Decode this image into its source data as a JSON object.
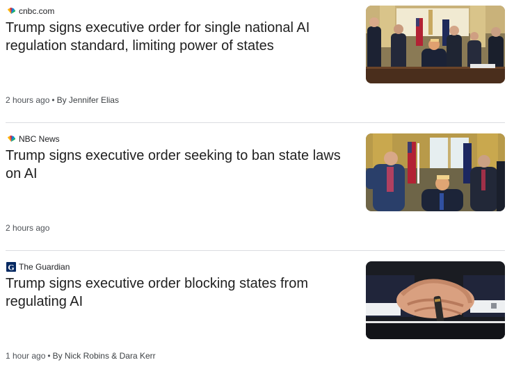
{
  "articles": [
    {
      "source": "cnbc.com",
      "source_icon": "nbc-peacock-icon",
      "headline": "Trump signs executive order for single national AI regulation standard, limiting power of states",
      "time": "2 hours ago",
      "separator": "•",
      "author": "By Jennifer Elias",
      "thumbnail_icon": "oval-office-signing-photo"
    },
    {
      "source": "NBC News",
      "source_icon": "nbc-peacock-icon",
      "headline": "Trump signs executive order seeking to ban state laws on AI",
      "time": "2 hours ago",
      "thumbnail_icon": "oval-office-speaker-photo"
    },
    {
      "source": "The Guardian",
      "source_icon": "guardian-g-icon",
      "headline": "Trump signs executive order blocking states from regulating AI",
      "time": "1 hour ago",
      "separator": "•",
      "author": "By Nick Robins & Dara Kerr",
      "thumbnail_icon": "clasped-hands-photo"
    }
  ],
  "colors": {
    "headline": "#1f1f1f",
    "meta": "#4d5156",
    "divider": "#dadce0",
    "guardian_blue": "#052962"
  }
}
